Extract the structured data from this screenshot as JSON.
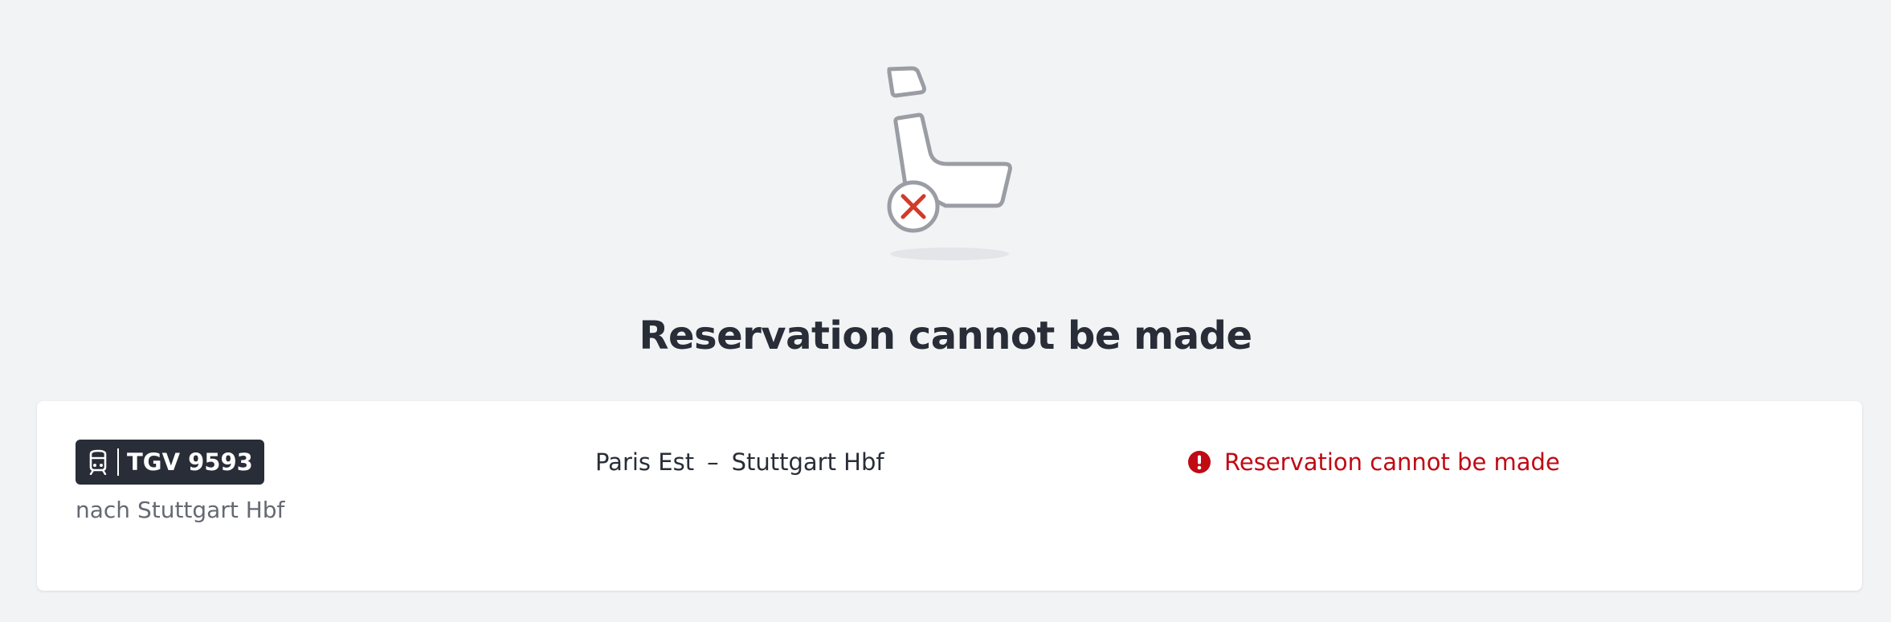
{
  "colors": {
    "background": "#f2f3f5",
    "card": "#ffffff",
    "text_primary": "#282d37",
    "text_secondary": "#646973",
    "error": "#c00a14",
    "badge_bg": "#282d37"
  },
  "illustration": {
    "icon": "seat-unavailable-icon"
  },
  "page": {
    "title": "Reservation cannot be made"
  },
  "connection": {
    "train_icon": "train-front-icon",
    "train_number": "TGV 9593",
    "destination": "nach Stuttgart Hbf",
    "route_from": "Paris Est",
    "route_separator": "–",
    "route_to": "Stuttgart Hbf",
    "status_icon": "error-circle-icon",
    "status_text": "Reservation cannot be made"
  }
}
